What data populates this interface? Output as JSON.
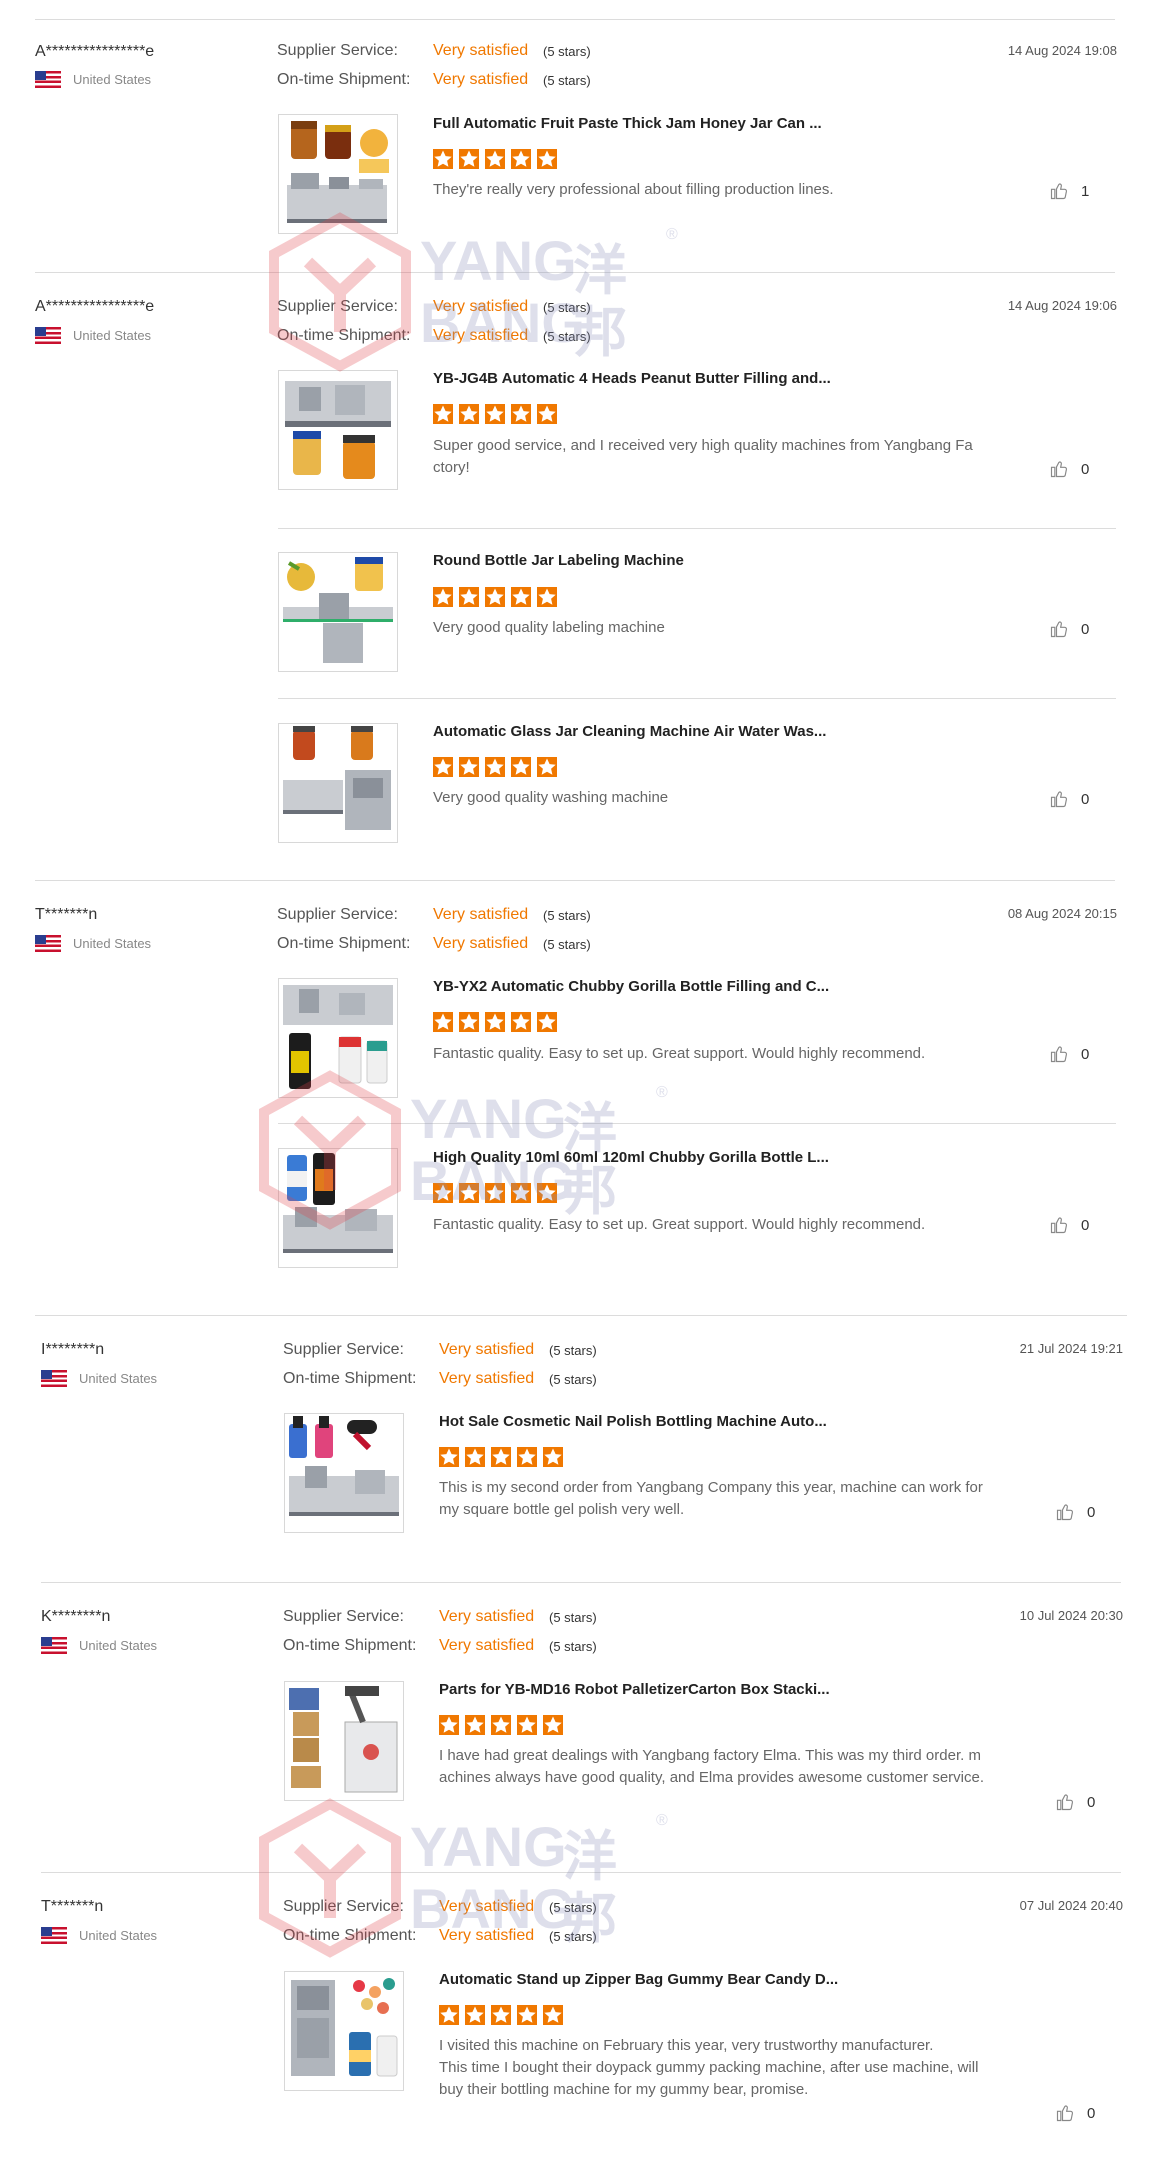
{
  "labels": {
    "supplier_service": "Supplier Service:",
    "on_time_shipment": "On-time Shipment:"
  },
  "watermark": {
    "line1": "YANG",
    "line2": "BANG",
    "cjk1": "洋",
    "cjk2": "邦",
    "mark": "®"
  },
  "colors": {
    "accent": "#f07800",
    "text": "#333333",
    "muted": "#888888",
    "divider": "#dcdcdc"
  },
  "reviews": [
    {
      "reviewer": "A****************e",
      "country": "United States",
      "date": "14 Aug 2024 19:08",
      "supplier_service": {
        "value": "Very satisfied",
        "stars": "(5 stars)"
      },
      "on_time_shipment": {
        "value": "Very satisfied",
        "stars": "(5 stars)"
      },
      "items": [
        {
          "title": "Full Automatic Fruit Paste Thick Jam Honey Jar Can ...",
          "rating": 5,
          "comment": "They're really very professional about filling production lines.",
          "likes": "1"
        }
      ]
    },
    {
      "reviewer": "A****************e",
      "country": "United States",
      "date": "14 Aug 2024 19:06",
      "supplier_service": {
        "value": "Very satisfied",
        "stars": "(5 stars)"
      },
      "on_time_shipment": {
        "value": "Very satisfied",
        "stars": "(5 stars)"
      },
      "items": [
        {
          "title": "YB-JG4B Automatic 4 Heads Peanut Butter Filling and...",
          "rating": 5,
          "comment": "Super good service, and I received very high quality machines from Yangbang Factory!",
          "likes": "0"
        },
        {
          "title": "Round Bottle Jar Labeling Machine",
          "rating": 5,
          "comment": "Very good quality labeling machine",
          "likes": "0"
        },
        {
          "title": "Automatic Glass Jar Cleaning Machine Air Water Was...",
          "rating": 5,
          "comment": "Very good quality washing machine",
          "likes": "0"
        }
      ]
    },
    {
      "reviewer": "T*******n",
      "country": "United States",
      "date": "08 Aug 2024 20:15",
      "supplier_service": {
        "value": "Very satisfied",
        "stars": "(5 stars)"
      },
      "on_time_shipment": {
        "value": "Very satisfied",
        "stars": "(5 stars)"
      },
      "items": [
        {
          "title": "YB-YX2 Automatic Chubby Gorilla Bottle Filling and C...",
          "rating": 5,
          "comment": "Fantastic quality. Easy to set up. Great support. Would highly recommend.",
          "likes": "0"
        },
        {
          "title": "High Quality 10ml 60ml 120ml Chubby Gorilla Bottle L...",
          "rating": 5,
          "comment": "Fantastic quality. Easy to set up. Great support. Would highly recommend.",
          "likes": "0"
        }
      ]
    },
    {
      "reviewer": "I********n",
      "country": "United States",
      "date": "21 Jul 2024 19:21",
      "supplier_service": {
        "value": "Very satisfied",
        "stars": "(5 stars)"
      },
      "on_time_shipment": {
        "value": "Very satisfied",
        "stars": "(5 stars)"
      },
      "items": [
        {
          "title": "Hot Sale Cosmetic Nail Polish Bottling Machine Auto...",
          "rating": 5,
          "comment": "This is my second order from Yangbang Company this year, machine can work for my square bottle gel polish very well.",
          "likes": "0"
        }
      ]
    },
    {
      "reviewer": "K********n",
      "country": "United States",
      "date": "10 Jul 2024 20:30",
      "supplier_service": {
        "value": "Very satisfied",
        "stars": "(5 stars)"
      },
      "on_time_shipment": {
        "value": "Very satisfied",
        "stars": "(5 stars)"
      },
      "items": [
        {
          "title": "Parts for YB-MD16 Robot PalletizerCarton Box Stacki...",
          "rating": 5,
          "comment": "I have had great dealings with Yangbang factory Elma. This was my third order. machines always have good quality, and Elma provides awesome customer service.",
          "likes": "0"
        }
      ]
    },
    {
      "reviewer": "T*******n",
      "country": "United States",
      "date": "07 Jul 2024 20:40",
      "supplier_service": {
        "value": "Very satisfied",
        "stars": "(5 stars)"
      },
      "on_time_shipment": {
        "value": "Very satisfied",
        "stars": "(5 stars)"
      },
      "items": [
        {
          "title": "Automatic Stand up Zipper Bag Gummy Bear Candy D...",
          "rating": 5,
          "comment": "I visited this machine on February this year, very trustworthy manufacturer.\nThis time I bought their doypack gummy packing machine, after use machine, will buy their bottling machine for my gummy bear, promise.",
          "likes": "0"
        }
      ]
    }
  ]
}
